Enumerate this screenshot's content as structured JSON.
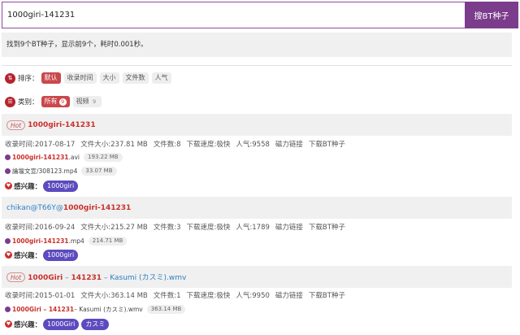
{
  "search": {
    "value": "1000giri-141231",
    "button_label": "搜BT种子"
  },
  "summary": "找到9个BT种子，显示前9个，耗时0.001秒。",
  "sort": {
    "label": "排序：",
    "options": [
      "默认",
      "收录时间",
      "大小",
      "文件数",
      "人气"
    ]
  },
  "category": {
    "label": "类别：",
    "options": [
      {
        "label": "所有",
        "count": "9"
      },
      {
        "label": "视频",
        "count": "9"
      }
    ]
  },
  "labels": {
    "indexed": "收录时间:",
    "size": "文件大小:",
    "files": "文件数:",
    "speed": "下载速度:",
    "popularity": "人气:",
    "magnet": "磁力链接",
    "download": "下载BT种子",
    "interest": "感兴趣：",
    "hot": "Hot"
  },
  "results": [
    {
      "hot": true,
      "title_parts": [
        {
          "text": "1000giri-141231",
          "style": "red"
        }
      ],
      "indexed": "2017-08-17",
      "size": "237.81 MB",
      "files": "8",
      "speed": "极快",
      "popularity": "9558",
      "file_list": [
        {
          "name_red": "1000giri-141231",
          "name_rest": ".avi",
          "size": "193.22 MB"
        },
        {
          "name_red": "",
          "name_rest": "論壇文宣/308123.mp4",
          "size": "33.07 MB"
        }
      ],
      "tags": [
        "1000giri"
      ]
    },
    {
      "hot": false,
      "title_parts": [
        {
          "text": "chikan@T66Y@",
          "style": "blue"
        },
        {
          "text": "1000giri-141231",
          "style": "red"
        }
      ],
      "indexed": "2016-09-24",
      "size": "215.27 MB",
      "files": "3",
      "speed": "极快",
      "popularity": "1789",
      "file_list": [
        {
          "name_red": "1000giri-141231",
          "name_rest": ".mp4",
          "size": "214.71 MB"
        }
      ],
      "tags": [
        "1000giri"
      ]
    },
    {
      "hot": true,
      "title_parts": [
        {
          "text": "1000Giri",
          "style": "red"
        },
        {
          "text": " – ",
          "style": "blue"
        },
        {
          "text": "141231",
          "style": "red"
        },
        {
          "text": " – Kasumi (カスミ).wmv",
          "style": "blue"
        }
      ],
      "indexed": "2015-01-01",
      "size": "363.14 MB",
      "files": "1",
      "speed": "极快",
      "popularity": "9950",
      "file_list": [
        {
          "name_red": "1000Giri – 141231",
          "name_rest": " – Kasumi (カスミ).wmv",
          "size": "363.14 MB"
        }
      ],
      "tags": [
        "1000Giri",
        "カスミ"
      ]
    }
  ]
}
